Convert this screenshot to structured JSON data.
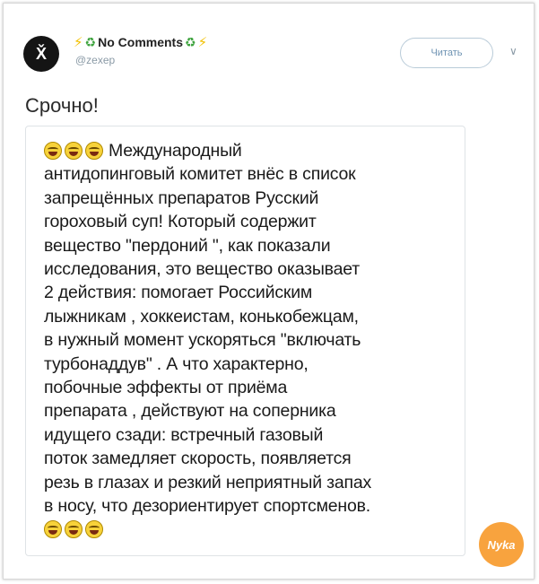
{
  "user": {
    "avatar_letter": "X̌",
    "display_name": "No Comments",
    "handle": "@zexep",
    "name_icons": [
      "lightning-icon",
      "recycle-icon"
    ]
  },
  "header": {
    "follow_label": "Читать",
    "menu_icon": "chevron-down-icon"
  },
  "tweet": {
    "text": "Срочно!"
  },
  "post": {
    "lead_emoji": [
      "laughing-emoji",
      "laughing-emoji",
      "laughing-emoji"
    ],
    "body": "Международный\nантидопинговый комитет внёс в список\nзапрещённых препаратов Русский\nгороховый суп! Который содержит\nвещество \"пердоний \", как показали\nисследования, это вещество оказывает\n2 действия: помогает  Российским\nлыжникам , хоккеистам, конькобежцам,\nв нужный момент  ускоряться \"включать\nтурбонаддув\" . А что характерно,\nпобочные эффекты от приёма\nпрепарата ,  действуют на соперника\nидущего сзади:  встречный газовый\nпоток замедляет скорость, появляется\nрезь в глазах и резкий неприятный запах\nв носу, что дезориентирует спортсменов.",
    "trail_emoji": [
      "laughing-emoji",
      "laughing-emoji",
      "laughing-emoji"
    ]
  },
  "watermark": {
    "text": "Nyka"
  }
}
